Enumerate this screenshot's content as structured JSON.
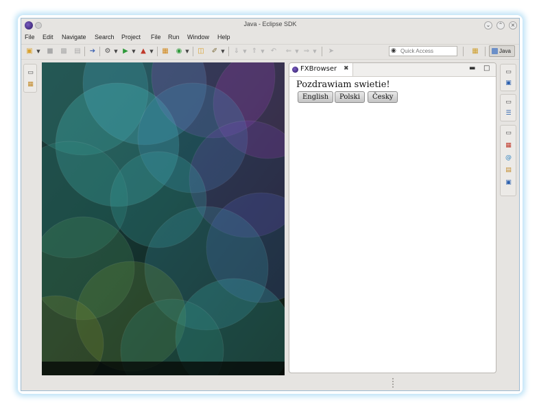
{
  "window": {
    "title": "Java - Eclipse SDK"
  },
  "menu": [
    "File",
    "Edit",
    "Navigate",
    "Search",
    "Project",
    "File",
    "Run",
    "Window",
    "Help"
  ],
  "toolbar": {
    "quick_access_placeholder": "Quick Access",
    "perspective_label": "Java"
  },
  "browser_view": {
    "tab_label": "FXBrowser",
    "greeting": "Pozdrawiam swietie!",
    "buttons": [
      "English",
      "Polski",
      "Česky"
    ]
  },
  "colors": {
    "window_bg": "#e6e4e1",
    "editor_bg": "#0c1512",
    "accent_glow": "#bfe3f7"
  }
}
